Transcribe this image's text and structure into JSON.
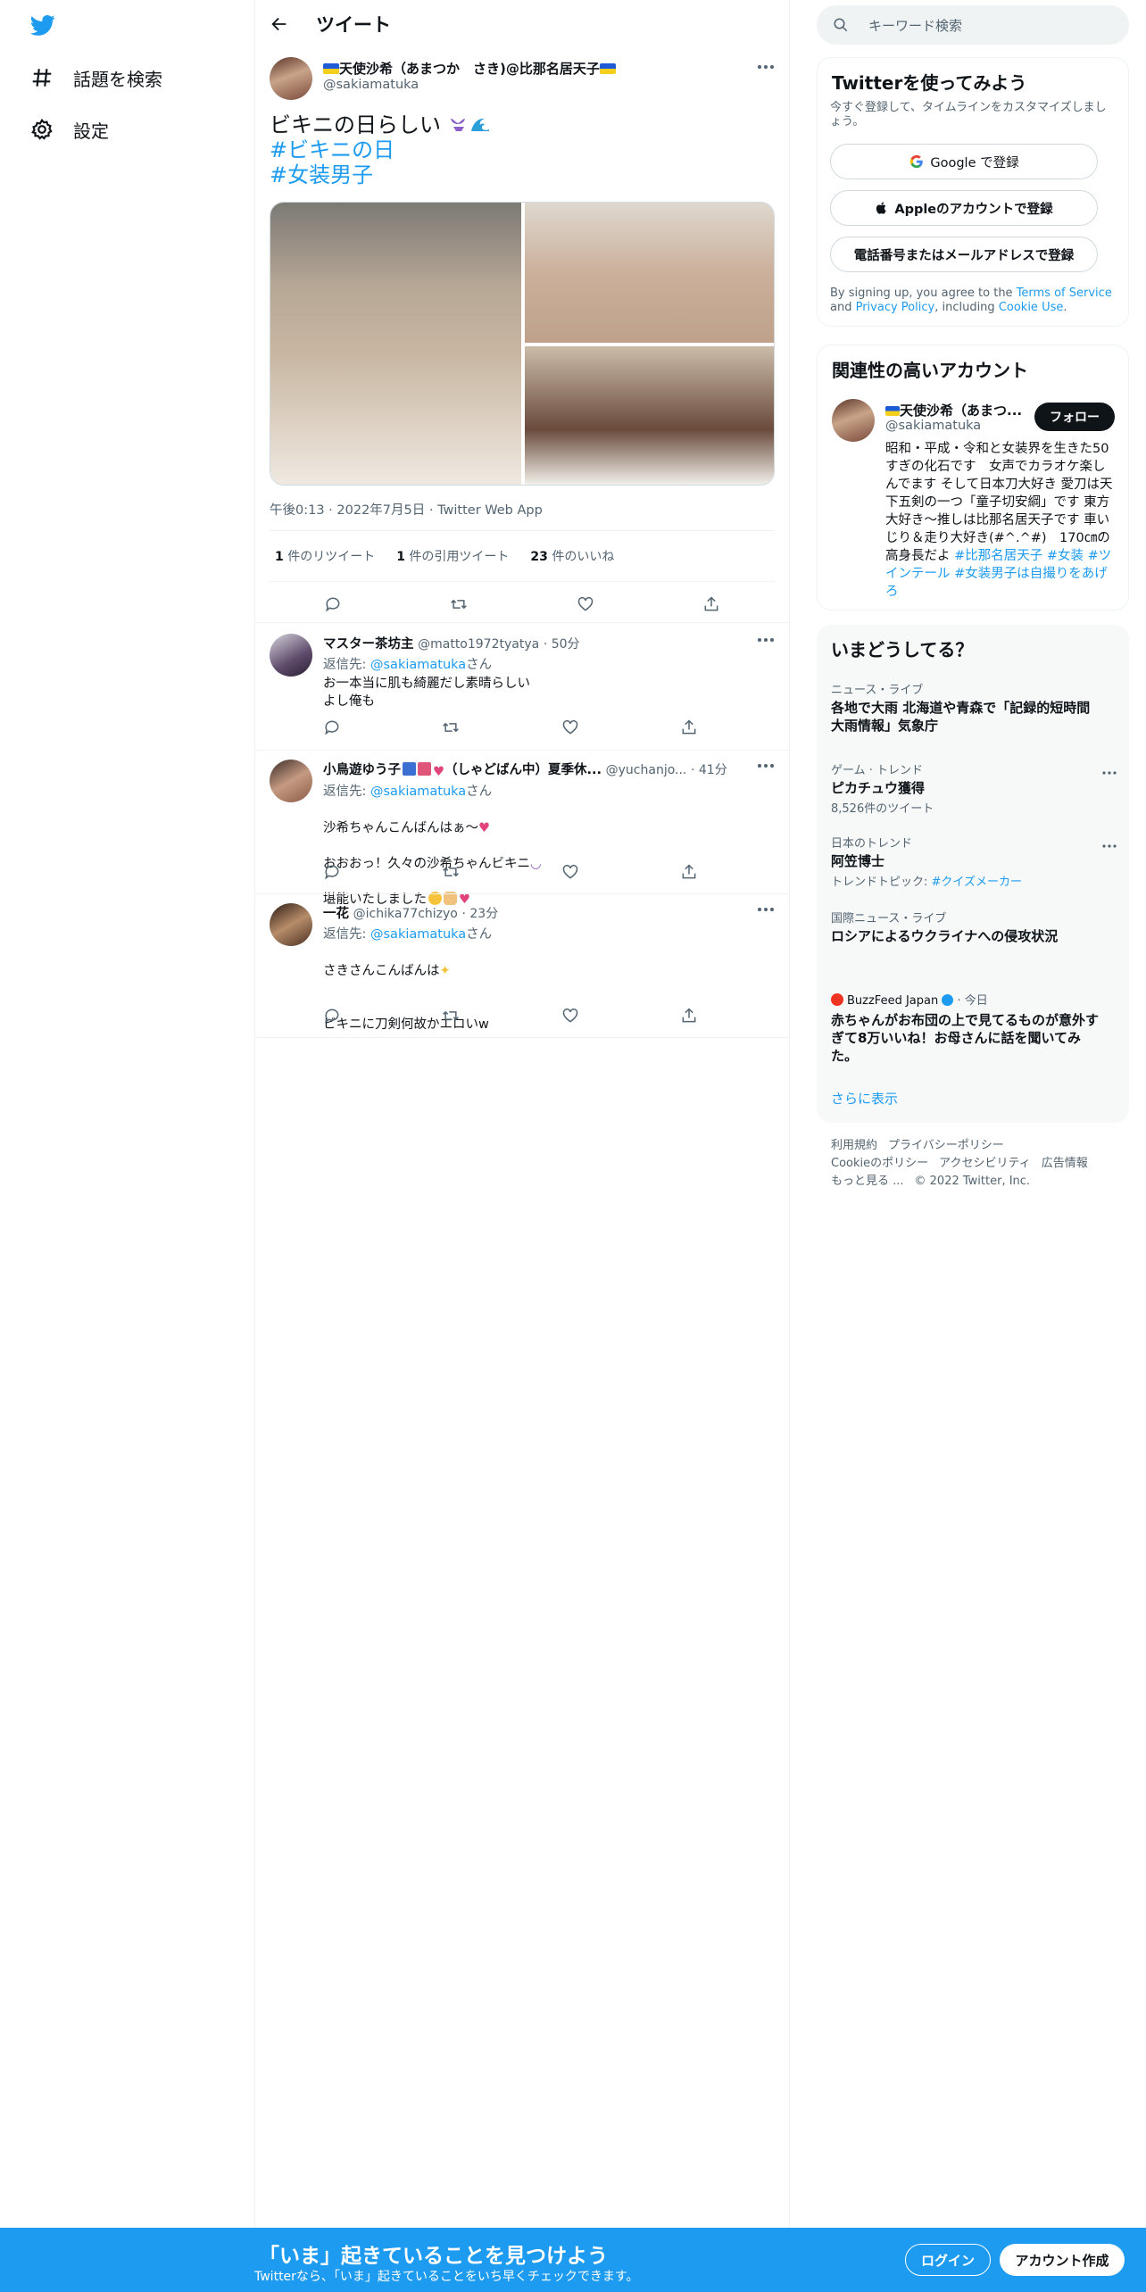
{
  "nav": {
    "explore_label": "話題を検索",
    "settings_label": "設定"
  },
  "header": {
    "title": "ツイート"
  },
  "tweet": {
    "display_name": "天使沙希（あまつか　さき)@比那名居天子",
    "handle": "@sakiamatuka",
    "text_line1": "ビキニの日らしい",
    "hashtag1": "#ビキニの日",
    "hashtag2": "#女装男子",
    "timestamp": "午後0:13 · 2022年7月5日 · Twitter Web App",
    "stats": {
      "retweets_count": "1",
      "retweets_label": "件のリツイート",
      "quotes_count": "1",
      "quotes_label": "件の引用ツイート",
      "likes_count": "23",
      "likes_label": "件のいいね"
    }
  },
  "replies": [
    {
      "name": "マスター茶坊主",
      "handle": "@matto1972tyatya",
      "time": "· 50分",
      "replying_prefix": "返信先: ",
      "replying_to": "@sakiamatuka",
      "replying_suffix": "さん",
      "text": "お一本当に肌も綺麗だし素晴らしい\nよし俺も"
    },
    {
      "name": "小鳥遊ゆう子",
      "name_suffix": "（しゃどばん中）夏季休...",
      "handle": "@yuchanjo...",
      "time": "· 41分",
      "replying_prefix": "返信先: ",
      "replying_to": "@sakiamatuka",
      "replying_suffix": "さん",
      "text_line1": "沙希ちゃんこんばんはぁ～",
      "text_line2": "おおおっ！久々の沙希ちゃんビキニ",
      "text_line3": "堪能いたしました"
    },
    {
      "name": "一花",
      "handle": "@ichika77chizyo",
      "time": "· 23分",
      "replying_prefix": "返信先: ",
      "replying_to": "@sakiamatuka",
      "replying_suffix": "さん",
      "text_line1": "さきさんこんばんは",
      "text_line2": "ビキニに刀剣何故かエロいw"
    }
  ],
  "search": {
    "placeholder": "キーワード検索"
  },
  "signup_card": {
    "title": "Twitterを使ってみよう",
    "subtitle": "今すぐ登録して、タイムラインをカスタマイズしましょう。",
    "google_label": "Google で登録",
    "apple_label": "Appleのアカウントで登録",
    "phone_label": "電話番号またはメールアドレスで登録",
    "terms_prefix": "By signing up, you agree to the ",
    "terms_link": "Terms of Service",
    "terms_and": " and ",
    "privacy_link": "Privacy Policy",
    "terms_including": ", including ",
    "cookie_link": "Cookie Use",
    "terms_end": "."
  },
  "relevant": {
    "title": "関連性の高いアカウント",
    "name": "天使沙希（あまつ...",
    "handle": "@sakiamatuka",
    "follow_label": "フォロー",
    "bio_text": "昭和・平成・令和と女装界を生きた50すぎの化石です　女声でカラオケ楽しんでます そして日本刀大好き 愛刀は天下五剣の一つ「童子切安綱」です 東方大好き～推しは比那名居天子です 車いじり＆走り大好き(#^.^#)　170㎝の高身長だよ ",
    "bio_tag1": "#比那名居天子",
    "bio_tag2": "#女装",
    "bio_tag3": "#ツインテール",
    "bio_tag4": "#女装男子は自撮りをあげろ"
  },
  "trends": {
    "title": "いまどうしてる？",
    "items": [
      {
        "category": "ニュース・ライブ",
        "name": "各地で大雨 北海道や青森で「記録的短時間大雨情報」気象庁"
      },
      {
        "category": "ゲーム · トレンド",
        "name": "ピカチュウ獲得",
        "sub": "8,526件のツイート"
      },
      {
        "category": "日本のトレンド",
        "name": "阿笠博士",
        "sub_prefix": "トレンドトピック: ",
        "sub_link": "#クイズメーカー"
      },
      {
        "category": "国際ニュース・ライブ",
        "name": "ロシアによるウクライナへの侵攻状況"
      },
      {
        "source": "BuzzFeed Japan",
        "time": "· 今日",
        "name": "赤ちゃんがお布団の上で見てるものが意外すぎて8万いいね！お母さんに話を聞いてみた。"
      }
    ],
    "show_more": "さらに表示"
  },
  "footer": {
    "terms": "利用規約",
    "privacy": "プライバシーポリシー",
    "cookie": "Cookieのポリシー",
    "accessibility": "アクセシビリティ",
    "ads": "広告情報",
    "more": "もっと見る ...",
    "copyright": "© 2022 Twitter, Inc."
  },
  "banner": {
    "headline": "「いま」起きていることを見つけよう",
    "subtext": "Twitterなら、「いま」起きていることをいち早くチェックできます。",
    "login_label": "ログイン",
    "signup_label": "アカウント作成"
  },
  "colors": {
    "accent": "#1d9bf0",
    "text": "#0f1419",
    "secondary": "#536471",
    "border": "#eff3f4"
  }
}
